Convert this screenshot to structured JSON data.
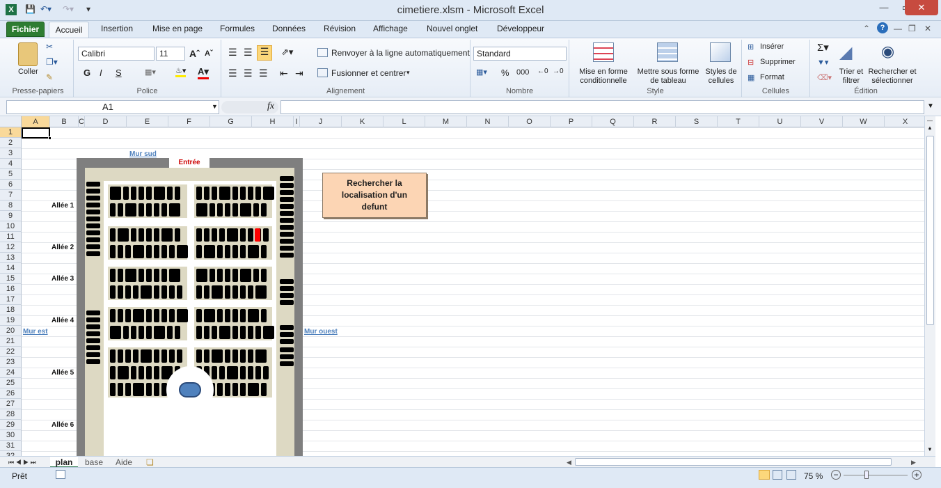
{
  "window": {
    "title": "cimetiere.xlsm  -  Microsoft Excel"
  },
  "menu": {
    "file": "Fichier",
    "tabs": [
      "Accueil",
      "Insertion",
      "Mise en page",
      "Formules",
      "Données",
      "Révision",
      "Affichage",
      "Nouvel onglet",
      "Développeur"
    ]
  },
  "ribbon": {
    "clipboard": {
      "paste": "Coller",
      "label": "Presse-papiers"
    },
    "font": {
      "name": "Calibri",
      "size": "11",
      "bold": "G",
      "italic": "I",
      "underline": "S",
      "label": "Police"
    },
    "alignment": {
      "wrap": "Renvoyer à la ligne automatiquement",
      "merge": "Fusionner et centrer",
      "label": "Alignement"
    },
    "number": {
      "format": "Standard",
      "percent": "%",
      "thousands": "000",
      "label": "Nombre"
    },
    "style": {
      "cond": "Mise en forme conditionnelle",
      "table": "Mettre sous forme de tableau",
      "cell_styles": "Styles de cellules",
      "label": "Style"
    },
    "cells": {
      "insert": "Insérer",
      "delete": "Supprimer",
      "format": "Format",
      "label": "Cellules"
    },
    "edit": {
      "sort": "Trier et filtrer",
      "find": "Rechercher et sélectionner",
      "label": "Édition"
    }
  },
  "formula": {
    "namebox": "A1",
    "fx": "fx",
    "content": ""
  },
  "columns": [
    "A",
    "B",
    "C",
    "D",
    "E",
    "F",
    "G",
    "H",
    "I",
    "J",
    "K",
    "L",
    "M",
    "N",
    "O",
    "P",
    "Q",
    "R",
    "S",
    "T",
    "U",
    "V",
    "W",
    "X"
  ],
  "rows": [
    "1",
    "2",
    "3",
    "4",
    "5",
    "6",
    "7",
    "8",
    "9",
    "10",
    "11",
    "12",
    "13",
    "14",
    "15",
    "16",
    "17",
    "18",
    "19",
    "20",
    "21",
    "22",
    "23",
    "24",
    "25",
    "26",
    "27",
    "28",
    "29",
    "30",
    "31",
    "32"
  ],
  "sheet": {
    "entrance": "Entrée",
    "wall_south": "Mur sud",
    "wall_east": "Mur est",
    "wall_west": "Mur ouest",
    "aisles": [
      "Allée 1",
      "Allée 2",
      "Allée 3",
      "Allée 4",
      "Allée 5",
      "Allée 6"
    ],
    "search_button": "Rechercher la localisation d'un defunt",
    "highlight_color": "#ff0000",
    "button_color": "#fcd5b4"
  },
  "sheettabs": [
    "plan",
    "base",
    "Aide"
  ],
  "status": {
    "ready": "Prêt",
    "zoom": "75 %"
  }
}
